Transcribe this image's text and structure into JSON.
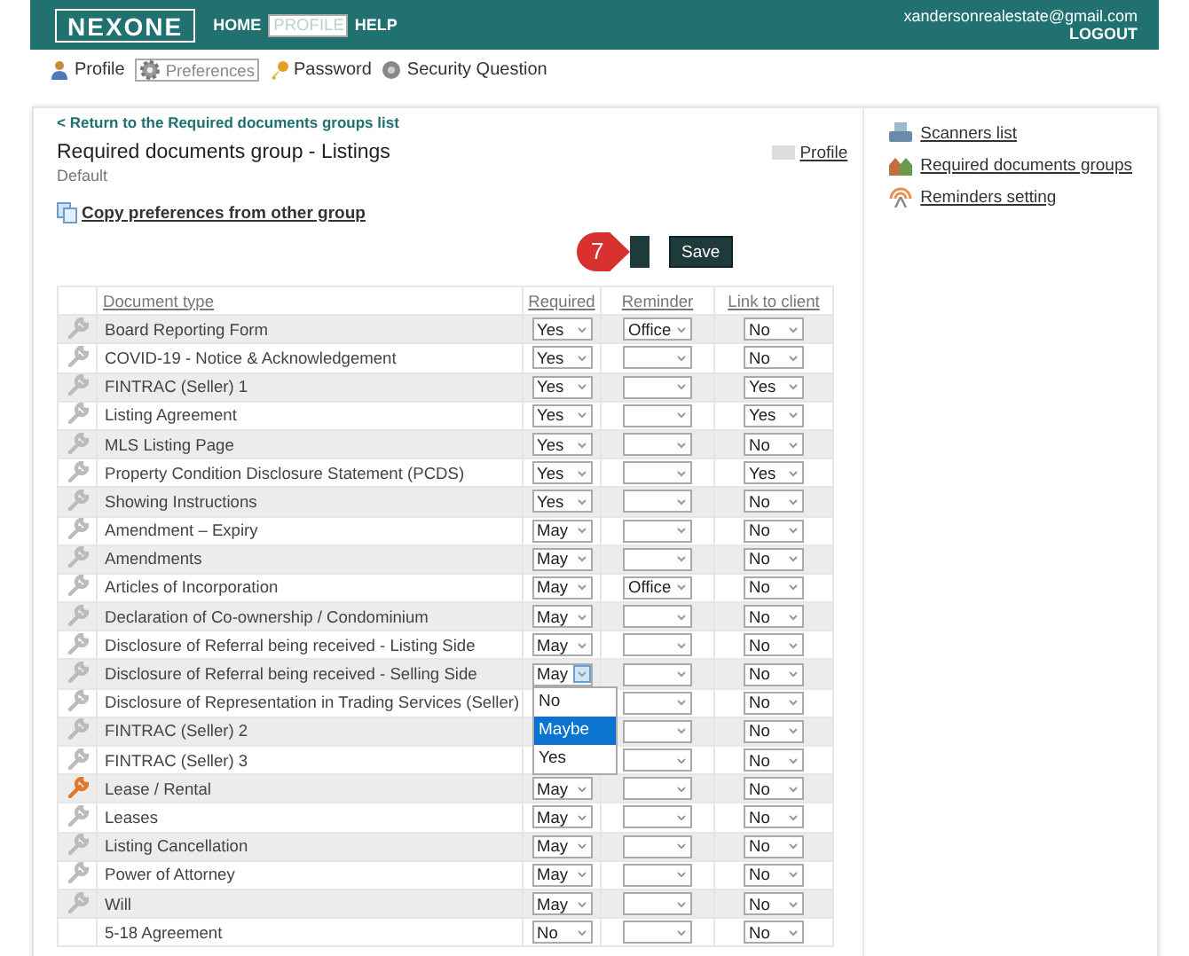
{
  "header": {
    "logo": "NEXONE",
    "nav": [
      {
        "label": "HOME",
        "selected": false
      },
      {
        "label": "PROFILE",
        "selected": true
      },
      {
        "label": "HELP",
        "selected": false
      }
    ],
    "email": "xandersonrealestate@gmail.com",
    "logout": "LOGOUT"
  },
  "subnav": [
    {
      "label": "Profile",
      "selected": false
    },
    {
      "label": "Preferences",
      "selected": true
    },
    {
      "label": "Password",
      "selected": false
    },
    {
      "label": "Security Question",
      "selected": false
    }
  ],
  "back_link": "< Return to the Required documents groups list",
  "title": "Required documents group - Listings",
  "profile_link": "Profile",
  "subtitle": "Default",
  "copy_link": "Copy preferences from other group",
  "callout": {
    "number": "7"
  },
  "save_button": "Save",
  "table": {
    "columns": [
      "Document type",
      "Required",
      "Reminder",
      "Link to client"
    ],
    "rows": [
      {
        "name": "Board Reporting Form",
        "required": "Yes",
        "reminder": "Office",
        "link": "No",
        "has_tool": true,
        "tool_highlighted": false
      },
      {
        "name": "COVID-19 - Notice & Acknowledgement",
        "required": "Yes",
        "link": "No",
        "has_tool": true,
        "tool_highlighted": false
      },
      {
        "name": "FINTRAC (Seller) 1",
        "required": "Yes",
        "link": "Yes",
        "has_tool": true,
        "tool_highlighted": false
      },
      {
        "name": "Listing Agreement",
        "required": "Yes",
        "link": "Yes",
        "has_tool": true,
        "tool_highlighted": false
      },
      {
        "name": "MLS Listing Page",
        "required": "Yes",
        "link": "No",
        "has_tool": true,
        "tool_highlighted": false
      },
      {
        "name": "Property Condition Disclosure Statement (PCDS)",
        "required": "Yes",
        "link": "Yes",
        "has_tool": true,
        "tool_highlighted": false
      },
      {
        "name": "Showing Instructions",
        "required": "Yes",
        "link": "No",
        "has_tool": true,
        "tool_highlighted": false
      },
      {
        "name": "Amendment – Expiry",
        "required": "May",
        "link": "No",
        "has_tool": true,
        "tool_highlighted": false
      },
      {
        "name": "Amendments",
        "required": "May",
        "link": "No",
        "has_tool": true,
        "tool_highlighted": false
      },
      {
        "name": "Articles of Incorporation",
        "required": "May",
        "reminder": "Office",
        "link": "No",
        "has_tool": true,
        "tool_highlighted": false
      },
      {
        "name": "Declaration of Co-ownership / Condominium",
        "required": "May",
        "link": "No",
        "has_tool": true,
        "tool_highlighted": false
      },
      {
        "name": "Disclosure of Referral being received - Listing Side",
        "required": "May",
        "link": "No",
        "has_tool": true,
        "tool_highlighted": false
      },
      {
        "name": "Disclosure of Referral being received - Selling Side",
        "required": "May",
        "link": "No",
        "has_tool": true,
        "tool_highlighted": false,
        "dropdown_open": true
      },
      {
        "name": "Disclosure of Representation in Trading Services (Seller)",
        "link": "No",
        "has_tool": true,
        "tool_highlighted": false
      },
      {
        "name": "FINTRAC (Seller) 2",
        "link": "No",
        "has_tool": true,
        "tool_highlighted": false
      },
      {
        "name": "FINTRAC (Seller) 3",
        "link": "No",
        "has_tool": true,
        "tool_highlighted": false
      },
      {
        "name": "Lease / Rental",
        "required": "May",
        "link": "No",
        "has_tool": true,
        "tool_highlighted": true
      },
      {
        "name": "Leases",
        "required": "May",
        "link": "No",
        "has_tool": true,
        "tool_highlighted": false
      },
      {
        "name": "Listing Cancellation",
        "required": "May",
        "link": "No",
        "has_tool": true,
        "tool_highlighted": false
      },
      {
        "name": "Power of Attorney",
        "required": "May",
        "link": "No",
        "has_tool": true,
        "tool_highlighted": false
      },
      {
        "name": "Will",
        "required": "May",
        "link": "No",
        "has_tool": true,
        "tool_highlighted": false
      },
      {
        "name": "5-18 Agreement",
        "required": "No",
        "link": "No",
        "has_tool": false
      }
    ]
  },
  "dropdown_options": [
    {
      "label": "No",
      "selected": false
    },
    {
      "label": "Maybe",
      "selected": true
    },
    {
      "label": "Yes",
      "selected": false
    }
  ],
  "sidebar": [
    {
      "label": "Scanners list"
    },
    {
      "label": "Required documents groups"
    },
    {
      "label": "Reminders setting"
    }
  ]
}
